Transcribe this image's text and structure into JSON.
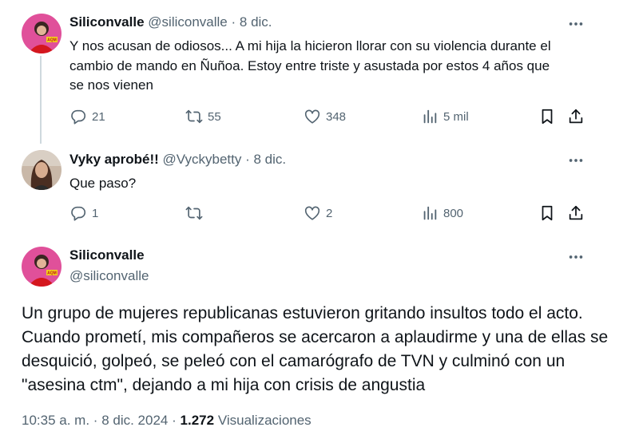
{
  "tweets": [
    {
      "name": "Siliconvalle",
      "handle": "@siliconvalle",
      "date": "8 dic.",
      "text": "Y nos acusan de odiosos... A mi hija la hicieron llorar con su violencia durante el cambio de mando en Ñuñoa. Estoy entre triste y asustada por estos 4 años que se nos vienen",
      "replies": "21",
      "reposts": "55",
      "likes": "348",
      "views": "5 mil"
    },
    {
      "name": "Vyky aprobé!!",
      "handle": "@Vyckybetty",
      "date": "8 dic.",
      "text": "Que paso?",
      "replies": "1",
      "reposts": "",
      "likes": "2",
      "views": "800"
    }
  ],
  "main": {
    "name": "Siliconvalle",
    "handle": "@siliconvalle",
    "text": "Un grupo de mujeres republicanas estuvieron gritando insultos todo el acto. Cuando prometí, mis compañeros se acercaron a aplaudirme y una de ellas se desquició, golpeó, se peleó con el camarógrafo de TVN y culminó con un \"asesina ctm\", dejando a mi hija con crisis de angustia",
    "time": "10:35 a. m.",
    "date": "8 dic. 2024",
    "views_count": "1.272",
    "views_label": "Visualizaciones"
  },
  "separator": "·",
  "avatar_badge": "AQM",
  "icons": [
    "reply-icon",
    "repost-icon",
    "like-icon",
    "views-icon",
    "bookmark-icon",
    "share-icon",
    "more-icon"
  ],
  "colors": {
    "text": "#0f1419",
    "secondary": "#536471",
    "thread_line": "#cfd9de"
  }
}
